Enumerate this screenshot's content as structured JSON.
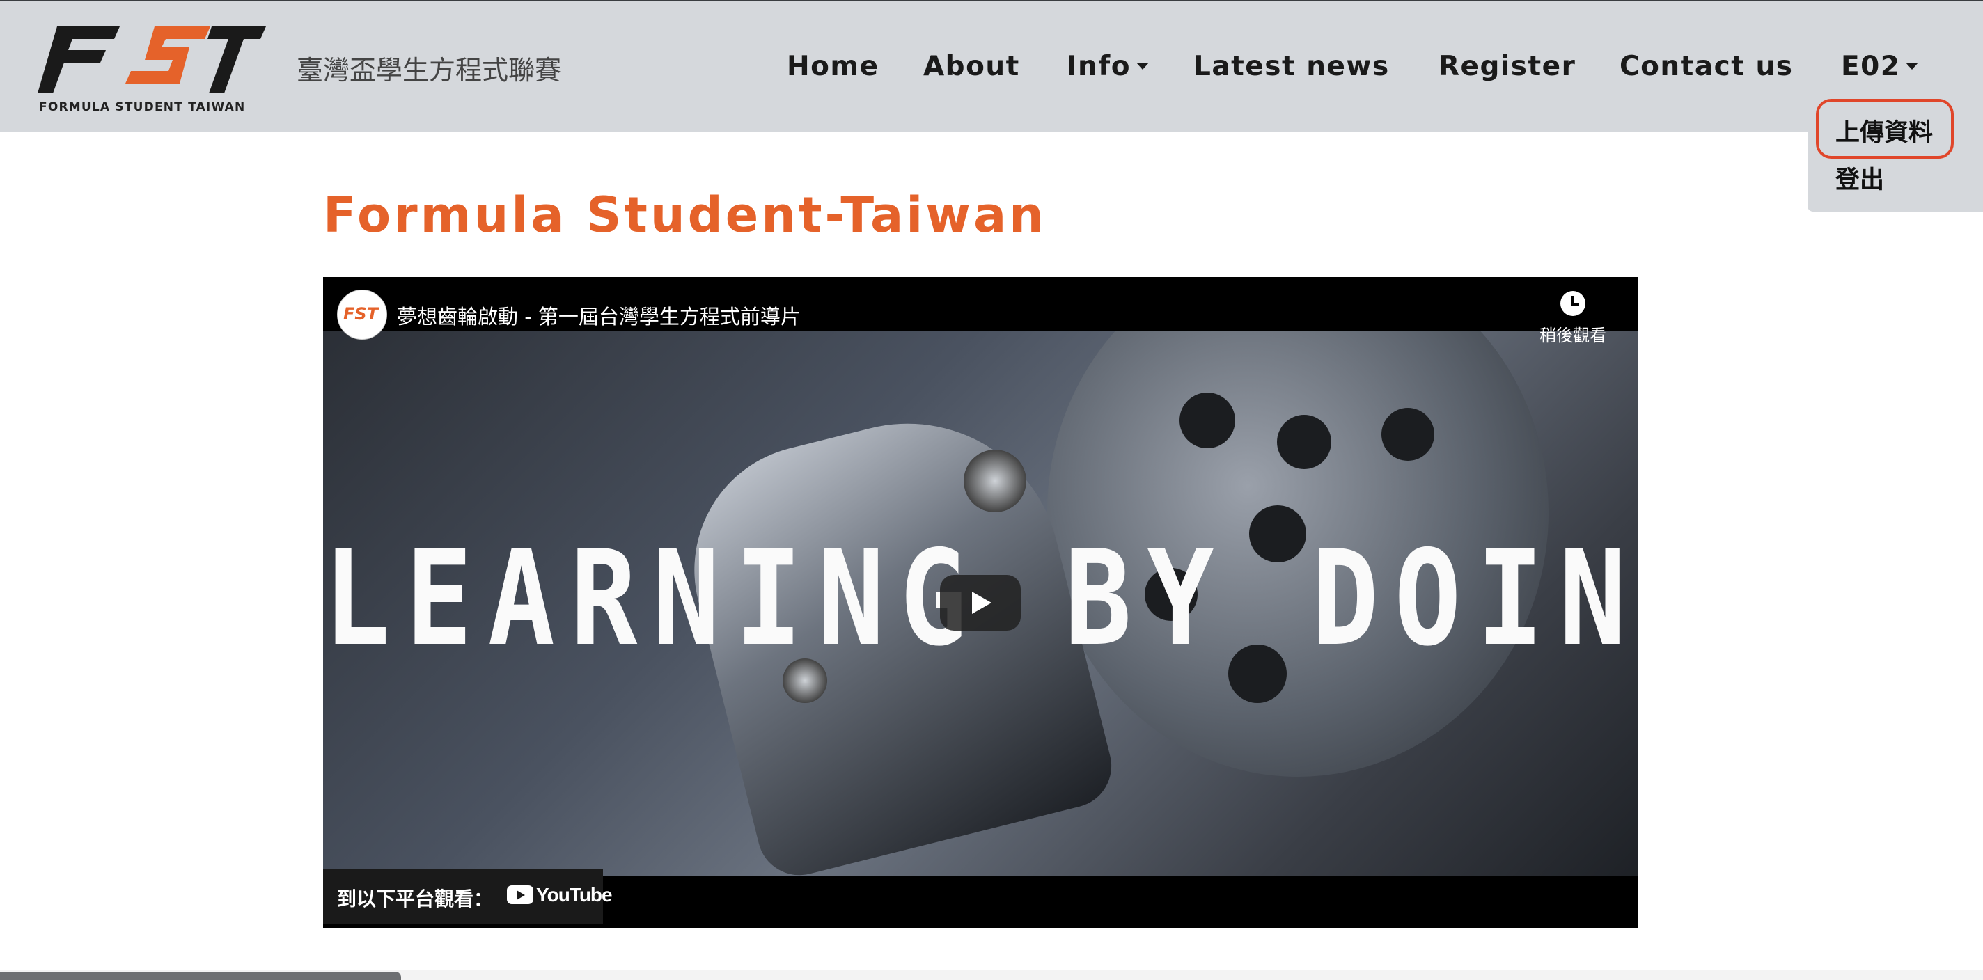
{
  "header": {
    "logo_text": "FST",
    "logo_subtext": "FORMULA STUDENT TAIWAN",
    "site_name": "臺灣盃學生方程式聯賽",
    "nav": [
      "Home",
      "About",
      "Info",
      "Latest news",
      "Register",
      "Contact us",
      "E02"
    ]
  },
  "user_menu": {
    "items": [
      "上傳資料",
      "登出"
    ]
  },
  "main": {
    "title": "Formula Student-Taiwan"
  },
  "video": {
    "title": "夢想齒輪啟動 - 第一屆台灣學生方程式前導片",
    "channel_avatar_text": "FST",
    "watch_later_label": "稍後觀看",
    "frame_text": "LEARNING BY DOING",
    "watch_on_label": "到以下平台觀看：",
    "platform_name": "YouTube"
  },
  "colors": {
    "accent": "#e5622a",
    "navbar_bg": "#d5d8dc",
    "highlight": "#e0462a"
  }
}
